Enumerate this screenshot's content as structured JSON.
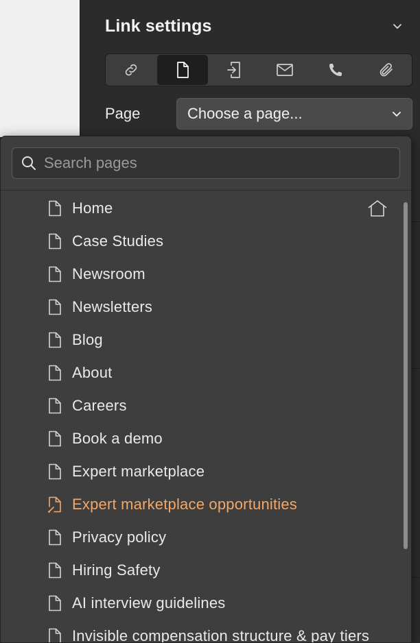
{
  "panel": {
    "title": "Link settings",
    "link_types": [
      {
        "icon": "link-icon",
        "name": "URL"
      },
      {
        "icon": "page-icon",
        "name": "Page",
        "active": true
      },
      {
        "icon": "section-icon",
        "name": "Section"
      },
      {
        "icon": "email-icon",
        "name": "Email"
      },
      {
        "icon": "phone-icon",
        "name": "Phone"
      },
      {
        "icon": "attachment-icon",
        "name": "Attachment"
      }
    ],
    "page_label": "Page",
    "page_select_value": "Choose a page..."
  },
  "dropdown": {
    "search_placeholder": "Search pages",
    "pages": [
      {
        "label": "Home",
        "is_home": true
      },
      {
        "label": "Case Studies"
      },
      {
        "label": "Newsroom"
      },
      {
        "label": "Newsletters"
      },
      {
        "label": "Blog"
      },
      {
        "label": "About"
      },
      {
        "label": "Careers"
      },
      {
        "label": "Book a demo"
      },
      {
        "label": "Expert marketplace"
      },
      {
        "label": "Expert marketplace opportunities",
        "highlight": true
      },
      {
        "label": "Privacy policy"
      },
      {
        "label": "Hiring Safety"
      },
      {
        "label": "AI interview guidelines"
      },
      {
        "label": "Invisible compensation structure & pay tiers"
      }
    ]
  },
  "colors": {
    "panel_bg": "#2b2b2b",
    "dropdown_bg": "#3e3e3e",
    "highlight_orange": "#f1a86a"
  }
}
